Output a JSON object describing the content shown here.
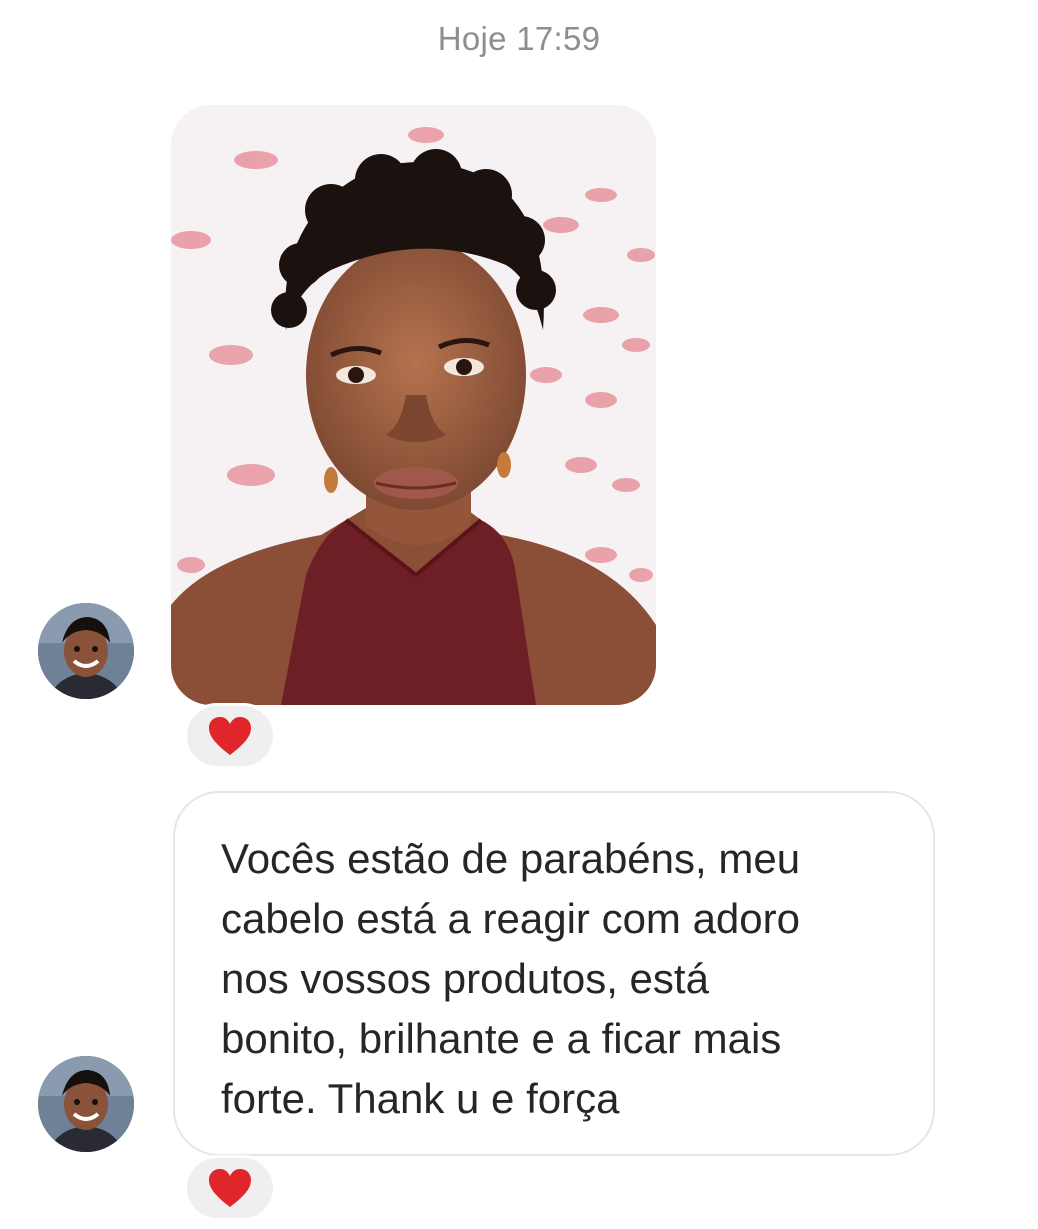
{
  "thread": {
    "timestamp": "Hoje 17:59",
    "messages": [
      {
        "kind": "image",
        "sender_avatar_icon": "user-avatar",
        "image_icon": "selfie-photo",
        "reaction": {
          "emoji": "heart-icon",
          "color": "#e0262a"
        }
      },
      {
        "kind": "text",
        "sender_avatar_icon": "user-avatar",
        "text": "Vocês estão de parabéns, meu\ncabelo está a reagir com adoro\nnos vossos produtos, está\nbonito, brilhante e a ficar mais\nforte. Thank u e força",
        "reaction": {
          "emoji": "heart-icon",
          "color": "#e0262a"
        }
      }
    ]
  },
  "colors": {
    "timestamp": "#8e8e8e",
    "message_text": "#262626",
    "bubble_border": "#e6e6e6",
    "reaction_bg": "#efefef",
    "heart": "#e0262a"
  }
}
